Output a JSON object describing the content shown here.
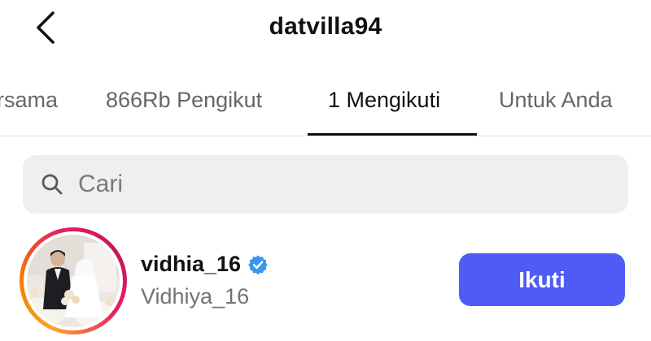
{
  "header": {
    "title": "datvilla94",
    "back_icon": "chevron-left-icon"
  },
  "tabs": [
    {
      "label": "rsama",
      "active": false
    },
    {
      "label": "866Rb Pengikut",
      "active": false
    },
    {
      "label": "1 Mengikuti",
      "active": true
    },
    {
      "label": "Untuk Anda",
      "active": false
    }
  ],
  "search": {
    "placeholder": "Cari",
    "icon": "search-icon"
  },
  "following": [
    {
      "username": "vidhia_16",
      "verified": true,
      "full_name": "Vidhiya_16",
      "avatar": "wedding-photo-avatar",
      "story_ring": true,
      "follow_label": "Ikuti"
    }
  ],
  "colors": {
    "follow_button": "#4f5bf5",
    "verified_badge": "#3897f0",
    "search_bg": "#efeff1",
    "tab_underline": "#111111"
  }
}
